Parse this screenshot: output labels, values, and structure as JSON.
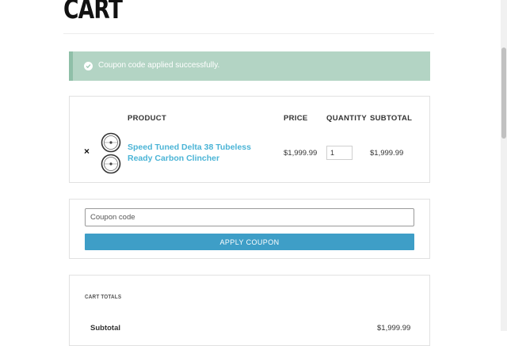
{
  "page": {
    "title": "CART"
  },
  "notice": {
    "message": "Coupon code applied successfully.",
    "color": "#b3d4c4"
  },
  "cart": {
    "headers": {
      "product": "PRODUCT",
      "price": "PRICE",
      "quantity": "QUANTITY",
      "subtotal": "SUBTOTAL"
    },
    "items": [
      {
        "remove_label": "×",
        "thumbnail_icon": "bicycle-wheels-icon",
        "name": "Speed Tuned Delta 38 Tubeless Ready Carbon Clincher",
        "price": "$1,999.99",
        "quantity": "1",
        "subtotal": "$1,999.99"
      }
    ]
  },
  "coupon": {
    "placeholder": "Coupon code",
    "button_label": "APPLY COUPON",
    "button_color": "#3e9ec7"
  },
  "totals": {
    "title": "CART TOTALS",
    "subtotal_label": "Subtotal",
    "subtotal_value": "$1,999.99"
  },
  "colors": {
    "link": "#4bb4d6"
  }
}
